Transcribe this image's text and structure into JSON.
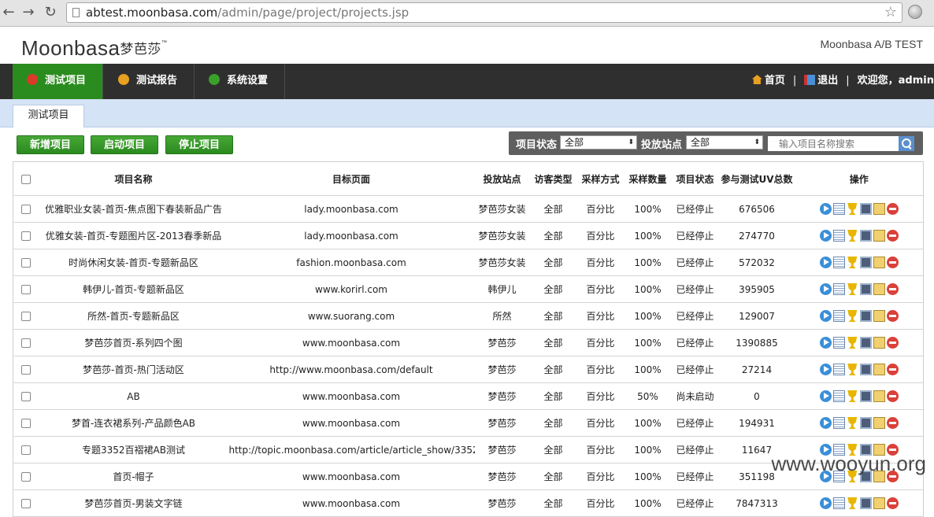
{
  "browser": {
    "url_host": "abtest.moonbasa.com",
    "url_path": "/admin/page/project/projects.jsp",
    "back_icon": "back-arrow-icon",
    "forward_icon": "forward-arrow-icon",
    "reload_icon": "reload-icon"
  },
  "header": {
    "logo_text": "Moonbasa",
    "logo_cn": "梦芭莎",
    "logo_tm": "™",
    "app_name": "Moonbasa A/B TEST"
  },
  "nav": {
    "tabs": [
      {
        "label": "测试项目",
        "icon_color": "#d93a2a"
      },
      {
        "label": "测试报告",
        "icon_color": "#e8a020"
      },
      {
        "label": "系统设置",
        "icon_color": "#3aa02a"
      }
    ],
    "home": "首页",
    "logout": "退出",
    "separator": "|",
    "welcome": "欢迎您，admin"
  },
  "subtab": {
    "label": "测试项目"
  },
  "actions": {
    "add": "新增项目",
    "start": "启动项目",
    "stop": "停止项目"
  },
  "filter": {
    "status_label": "项目状态",
    "status_value": "全部",
    "site_label": "投放站点",
    "site_value": "全部",
    "search_placeholder": "输入项目名称搜索"
  },
  "table": {
    "headers": {
      "name": "项目名称",
      "page": "目标页面",
      "site": "投放站点",
      "visitor": "访客类型",
      "method": "采样方式",
      "qty": "采样数量",
      "status": "项目状态",
      "uv": "参与测试UV总数",
      "ops": "操作"
    },
    "rows": [
      {
        "name": "优雅职业女装-首页-焦点图下春装新品广告",
        "page": "lady.moonbasa.com",
        "site": "梦芭莎女装",
        "visitor": "全部",
        "method": "百分比",
        "qty": "100%",
        "status": "已经停止",
        "uv": "676506"
      },
      {
        "name": "优雅女装-首页-专题图片区-2013春季新品",
        "page": "lady.moonbasa.com",
        "site": "梦芭莎女装",
        "visitor": "全部",
        "method": "百分比",
        "qty": "100%",
        "status": "已经停止",
        "uv": "274770"
      },
      {
        "name": "时尚休闲女装-首页-专题新品区",
        "page": "fashion.moonbasa.com",
        "site": "梦芭莎女装",
        "visitor": "全部",
        "method": "百分比",
        "qty": "100%",
        "status": "已经停止",
        "uv": "572032"
      },
      {
        "name": "韩伊儿-首页-专题新品区",
        "page": "www.korirl.com",
        "site": "韩伊儿",
        "visitor": "全部",
        "method": "百分比",
        "qty": "100%",
        "status": "已经停止",
        "uv": "395905"
      },
      {
        "name": "所然-首页-专题新品区",
        "page": "www.suorang.com",
        "site": "所然",
        "visitor": "全部",
        "method": "百分比",
        "qty": "100%",
        "status": "已经停止",
        "uv": "129007"
      },
      {
        "name": "梦芭莎首页-系列四个图",
        "page": "www.moonbasa.com",
        "site": "梦芭莎",
        "visitor": "全部",
        "method": "百分比",
        "qty": "100%",
        "status": "已经停止",
        "uv": "1390885"
      },
      {
        "name": "梦芭莎-首页-热门活动区",
        "page": "http://www.moonbasa.com/default",
        "site": "梦芭莎",
        "visitor": "全部",
        "method": "百分比",
        "qty": "100%",
        "status": "已经停止",
        "uv": "27214"
      },
      {
        "name": "AB",
        "page": "www.moonbasa.com",
        "site": "梦芭莎",
        "visitor": "全部",
        "method": "百分比",
        "qty": "50%",
        "status": "尚未启动",
        "uv": "0"
      },
      {
        "name": "梦首-连衣裙系列-产品颜色AB",
        "page": "www.moonbasa.com",
        "site": "梦芭莎",
        "visitor": "全部",
        "method": "百分比",
        "qty": "100%",
        "status": "已经停止",
        "uv": "194931"
      },
      {
        "name": "专题3352百褶裙AB测试",
        "page": "http://topic.moonbasa.com/article/article_show/3352",
        "site": "梦芭莎",
        "visitor": "全部",
        "method": "百分比",
        "qty": "100%",
        "status": "已经停止",
        "uv": "11647"
      },
      {
        "name": "首页-帽子",
        "page": "www.moonbasa.com",
        "site": "梦芭莎",
        "visitor": "全部",
        "method": "百分比",
        "qty": "100%",
        "status": "已经停止",
        "uv": "351198"
      },
      {
        "name": "梦芭莎首页-男装文字链",
        "page": "www.moonbasa.com",
        "site": "梦芭莎",
        "visitor": "全部",
        "method": "百分比",
        "qty": "100%",
        "status": "已经停止",
        "uv": "7847313"
      }
    ],
    "op_icons": [
      "play-icon",
      "table-icon",
      "trophy-icon",
      "monitor-icon",
      "edit-icon",
      "delete-icon"
    ]
  },
  "watermark": "www.wooyun.org"
}
